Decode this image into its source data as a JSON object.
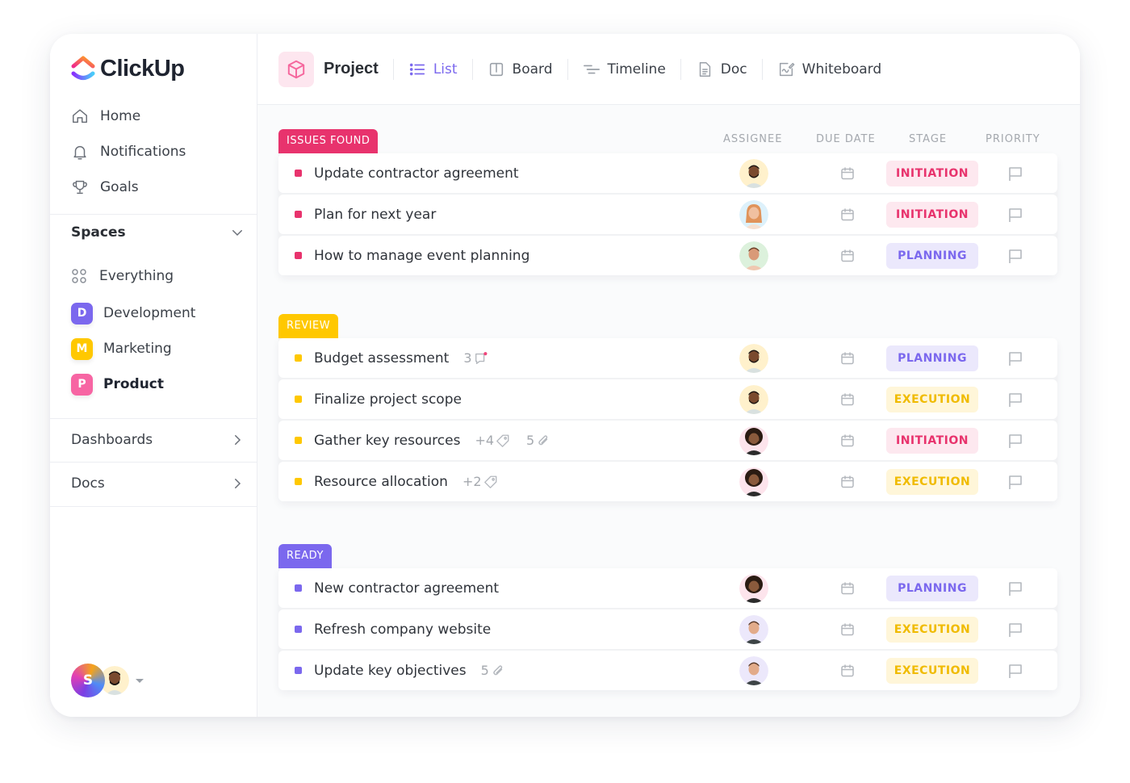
{
  "app": {
    "brand": "ClickUp"
  },
  "sidebar": {
    "nav": [
      {
        "label": "Home",
        "icon": "home-icon"
      },
      {
        "label": "Notifications",
        "icon": "bell-icon"
      },
      {
        "label": "Goals",
        "icon": "trophy-icon"
      }
    ],
    "spaces_title": "Spaces",
    "everything_label": "Everything",
    "spaces": [
      {
        "letter": "D",
        "label": "Development",
        "color": "#7b68ee",
        "active": false
      },
      {
        "letter": "M",
        "label": "Marketing",
        "color": "#ffc800",
        "active": false
      },
      {
        "letter": "P",
        "label": "Product",
        "color": "#f765a3",
        "active": true
      }
    ],
    "dashboards_label": "Dashboards",
    "docs_label": "Docs",
    "user_initial": "S"
  },
  "header": {
    "project_title": "Project",
    "tabs": [
      {
        "label": "List",
        "icon": "list-icon",
        "active": true
      },
      {
        "label": "Board",
        "icon": "board-icon",
        "active": false
      },
      {
        "label": "Timeline",
        "icon": "timeline-icon",
        "active": false
      },
      {
        "label": "Doc",
        "icon": "doc-icon",
        "active": false
      },
      {
        "label": "Whiteboard",
        "icon": "whiteboard-icon",
        "active": false
      }
    ]
  },
  "columns": {
    "assignee": "ASSIGNEE",
    "due_date": "DUE DATE",
    "stage": "STAGE",
    "priority": "PRIORITY"
  },
  "stages": {
    "INITIATION": {
      "fg": "#e8336d",
      "bg": "#fde8ef"
    },
    "PLANNING": {
      "fg": "#7b68ee",
      "bg": "#ebe8fc"
    },
    "EXECUTION": {
      "fg": "#f0bb00",
      "bg": "#fff6d9"
    }
  },
  "groups": [
    {
      "label": "ISSUES FOUND",
      "color": "#e8336d",
      "tasks": [
        {
          "name": "Update contractor agreement",
          "assignee": "man-beard-yellow",
          "stage": "INITIATION"
        },
        {
          "name": "Plan for next year",
          "assignee": "woman-blonde-blue",
          "stage": "INITIATION"
        },
        {
          "name": "How to manage event planning",
          "assignee": "woman-green",
          "stage": "PLANNING"
        }
      ]
    },
    {
      "label": "REVIEW",
      "color": "#ffc800",
      "tasks": [
        {
          "name": "Budget assessment",
          "assignee": "man-beard-yellow",
          "stage": "PLANNING",
          "comments": "3"
        },
        {
          "name": "Finalize project scope",
          "assignee": "man-beard-yellow",
          "stage": "EXECUTION"
        },
        {
          "name": "Gather key resources",
          "assignee": "man-afro-pink",
          "stage": "INITIATION",
          "tags": "+4",
          "attachments": "5"
        },
        {
          "name": "Resource allocation",
          "assignee": "man-afro-pink",
          "stage": "EXECUTION",
          "tags": "+2"
        }
      ]
    },
    {
      "label": "READY",
      "color": "#7b68ee",
      "tasks": [
        {
          "name": "New contractor agreement",
          "assignee": "man-afro-pink",
          "stage": "PLANNING"
        },
        {
          "name": "Refresh company website",
          "assignee": "man-bald-purple",
          "stage": "EXECUTION"
        },
        {
          "name": "Update key objectives",
          "assignee": "man-bald-purple",
          "stage": "EXECUTION",
          "attachments": "5"
        }
      ]
    }
  ]
}
